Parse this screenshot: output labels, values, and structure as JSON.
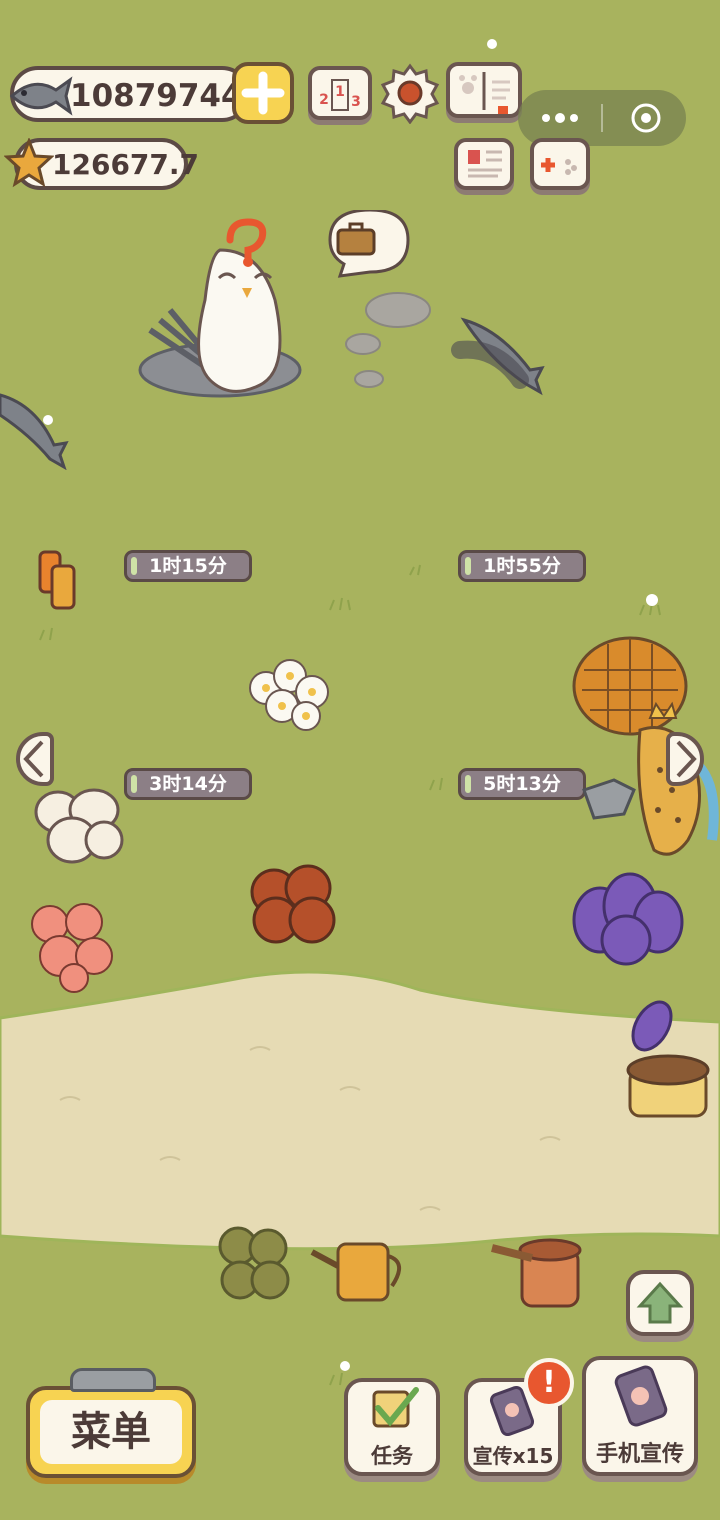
{
  "currency": {
    "fish_count": "10879744",
    "star_count": "126677.7"
  },
  "timers": [
    {
      "label": "1时15分"
    },
    {
      "label": "1时55分"
    },
    {
      "label": "3时14分"
    },
    {
      "label": "5时13分"
    }
  ],
  "podium_digits": "213",
  "buttons": {
    "menu": "菜单",
    "tasks": "任务",
    "promote": "宣传x15",
    "phone_promote": "手机宣传"
  },
  "notification_mark": "!",
  "colors": {
    "grass": "#a8b35e",
    "path": "#e6dbb4",
    "outline": "#5c4a45",
    "accent_yellow": "#f7d352",
    "notify_red": "#e8572f"
  },
  "icons": [
    "fish-icon",
    "star-icon",
    "plus-icon",
    "podium-icon",
    "gear-icon",
    "guide-book-icon",
    "id-card-icon",
    "gamepad-icon",
    "suitcase-icon",
    "checkbox-icon",
    "phone-icon",
    "up-arrow-icon",
    "left-arrow-icon",
    "right-arrow-icon",
    "more-dots-icon",
    "target-icon"
  ]
}
